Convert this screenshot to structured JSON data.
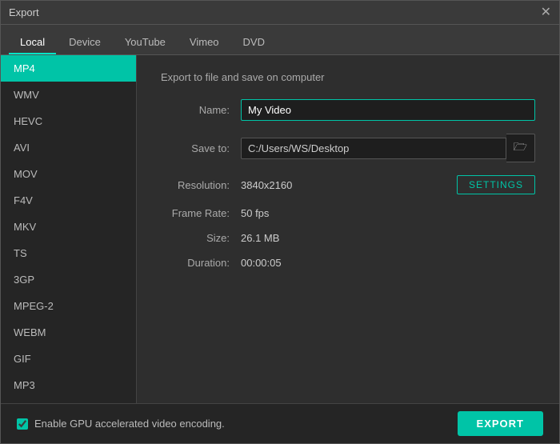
{
  "window": {
    "title": "Export"
  },
  "tabs": [
    {
      "id": "local",
      "label": "Local",
      "active": true
    },
    {
      "id": "device",
      "label": "Device",
      "active": false
    },
    {
      "id": "youtube",
      "label": "YouTube",
      "active": false
    },
    {
      "id": "vimeo",
      "label": "Vimeo",
      "active": false
    },
    {
      "id": "dvd",
      "label": "DVD",
      "active": false
    }
  ],
  "sidebar": {
    "items": [
      {
        "id": "mp4",
        "label": "MP4",
        "active": true
      },
      {
        "id": "wmv",
        "label": "WMV",
        "active": false
      },
      {
        "id": "hevc",
        "label": "HEVC",
        "active": false
      },
      {
        "id": "avi",
        "label": "AVI",
        "active": false
      },
      {
        "id": "mov",
        "label": "MOV",
        "active": false
      },
      {
        "id": "f4v",
        "label": "F4V",
        "active": false
      },
      {
        "id": "mkv",
        "label": "MKV",
        "active": false
      },
      {
        "id": "ts",
        "label": "TS",
        "active": false
      },
      {
        "id": "3gp",
        "label": "3GP",
        "active": false
      },
      {
        "id": "mpeg2",
        "label": "MPEG-2",
        "active": false
      },
      {
        "id": "webm",
        "label": "WEBM",
        "active": false
      },
      {
        "id": "gif",
        "label": "GIF",
        "active": false
      },
      {
        "id": "mp3",
        "label": "MP3",
        "active": false
      }
    ]
  },
  "main": {
    "section_title": "Export to file and save on computer",
    "name_label": "Name:",
    "name_value": "My Video",
    "save_to_label": "Save to:",
    "save_to_value": "C:/Users/WS/Desktop",
    "resolution_label": "Resolution:",
    "resolution_value": "3840x2160",
    "settings_label": "SETTINGS",
    "frame_rate_label": "Frame Rate:",
    "frame_rate_value": "50 fps",
    "size_label": "Size:",
    "size_value": "26.1 MB",
    "duration_label": "Duration:",
    "duration_value": "00:00:05"
  },
  "footer": {
    "gpu_label": "Enable GPU accelerated video encoding.",
    "export_label": "EXPORT"
  },
  "icons": {
    "close": "✕",
    "folder": "🗁"
  }
}
